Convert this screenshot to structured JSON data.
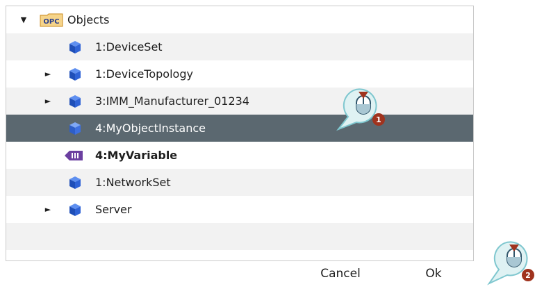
{
  "tree": {
    "root": {
      "label": "Objects",
      "icon": "opc-folder-icon",
      "icon_text": "OPC",
      "expander": "▼"
    },
    "items": [
      {
        "label": "1:DeviceSet",
        "icon": "object-cube-icon",
        "expander": ""
      },
      {
        "label": "1:DeviceTopology",
        "icon": "object-cube-icon",
        "expander": "►"
      },
      {
        "label": "3:IMM_Manufacturer_01234",
        "icon": "object-cube-icon",
        "expander": "►"
      },
      {
        "label": "4:MyObjectInstance",
        "icon": "object-cube-icon",
        "expander": "",
        "selected": true
      },
      {
        "label": "4:MyVariable",
        "icon": "variable-tag-icon",
        "expander": "",
        "bold": true
      },
      {
        "label": "1:NetworkSet",
        "icon": "object-cube-icon",
        "expander": ""
      },
      {
        "label": "Server",
        "icon": "object-cube-icon",
        "expander": "►"
      }
    ]
  },
  "buttons": {
    "cancel": "Cancel",
    "ok": "Ok"
  },
  "callouts": [
    {
      "step": "1",
      "icon": "mouse-click-icon"
    },
    {
      "step": "2",
      "icon": "mouse-click-icon"
    }
  ],
  "colors": {
    "selected_row": "#5b6870",
    "alt_row": "#f2f2f2",
    "cube_blue": "#1f4fb8",
    "variable_purple": "#6b3fa0",
    "opc_orange": "#e8a23a",
    "callout_teal": "#7fc7cf",
    "step_badge": "#a0331e"
  }
}
